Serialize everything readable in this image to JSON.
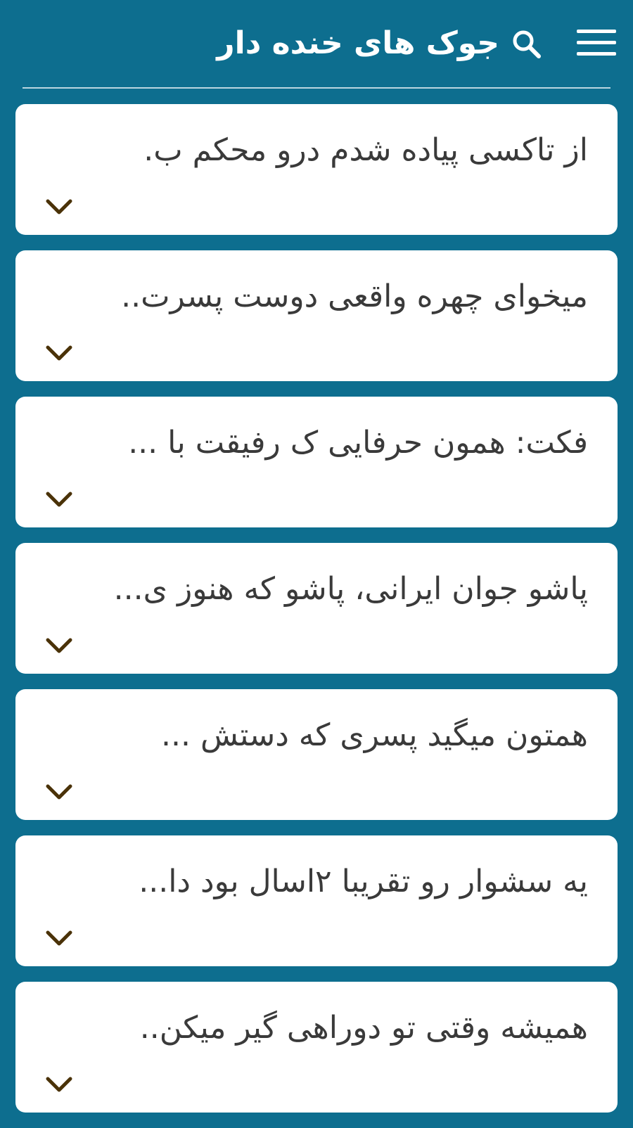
{
  "header": {
    "title": "جوک های خنده دار",
    "menu_icon": "hamburger-menu-icon",
    "search_icon": "search-icon"
  },
  "colors": {
    "background": "#0d6e8f",
    "card": "#ffffff",
    "text": "#3a3a3a",
    "chevron": "#4a3208"
  },
  "jokes": [
    {
      "text": "از تاکسی پیاده شدم  درو محکم ب."
    },
    {
      "text": "میخوای چهره واقعی دوست پسرت.."
    },
    {
      "text": "فکت: همون حرفایی ک رفیقت با ..."
    },
    {
      "text": "پاشو جوان ایرانی، پاشو که هنوز ی..."
    },
    {
      "text": "همتون میگید پسری که دستش ..."
    },
    {
      "text": "یه سشوار رو تقریبا ۲اسال بود دا..."
    },
    {
      "text": "همیشه وقتی تو دوراهی گیر میکن.."
    }
  ]
}
